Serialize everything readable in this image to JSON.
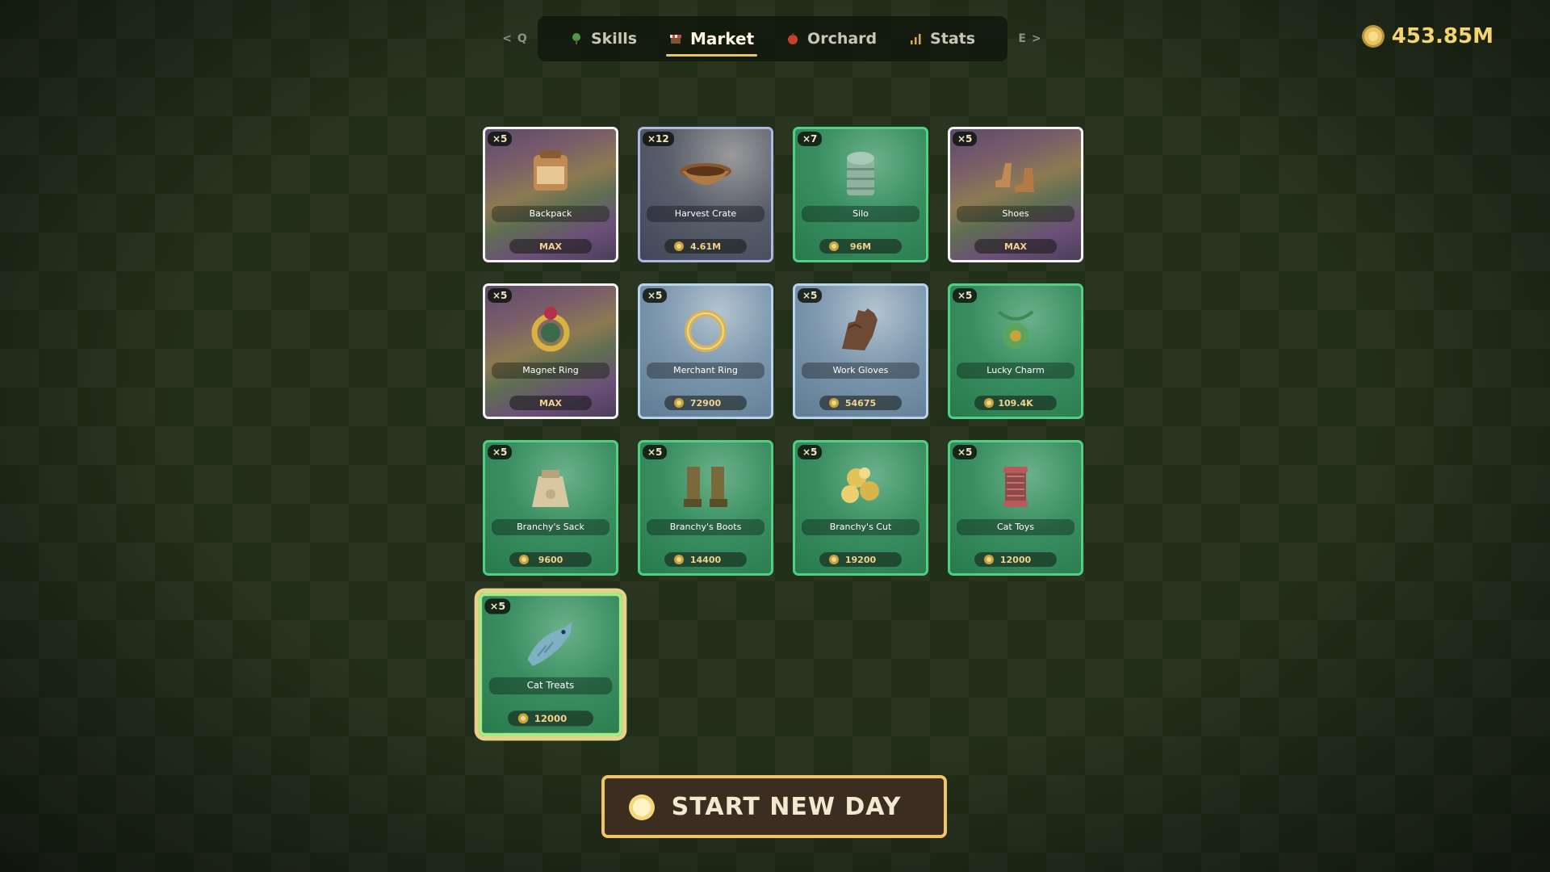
{
  "nav": {
    "prev_hint": "< Q",
    "next_hint": "E >",
    "tabs": [
      {
        "label": "Skills",
        "icon": "tree-icon",
        "active": false
      },
      {
        "label": "Market",
        "icon": "market-stall-icon",
        "active": true
      },
      {
        "label": "Orchard",
        "icon": "apple-icon",
        "active": false
      },
      {
        "label": "Stats",
        "icon": "bar-chart-icon",
        "active": false
      }
    ]
  },
  "currency": {
    "icon": "coin-icon",
    "total": "453.85M"
  },
  "items": [
    {
      "name": "Backpack",
      "qty": "×5",
      "price": "MAX",
      "style": "rainbow",
      "icon": "backpack-icon"
    },
    {
      "name": "Harvest Crate",
      "qty": "×12",
      "price": "4.61M",
      "style": "silver",
      "icon": "crate-icon"
    },
    {
      "name": "Silo",
      "qty": "×7",
      "price": "96M",
      "style": "green",
      "icon": "silo-icon"
    },
    {
      "name": "Shoes",
      "qty": "×5",
      "price": "MAX",
      "style": "rainbow",
      "icon": "shoes-icon"
    },
    {
      "name": "Magnet Ring",
      "qty": "×5",
      "price": "MAX",
      "style": "rainbow",
      "icon": "magnet-ring-icon"
    },
    {
      "name": "Merchant Ring",
      "qty": "×5",
      "price": "72900",
      "style": "sky",
      "icon": "ring-icon"
    },
    {
      "name": "Work Gloves",
      "qty": "×5",
      "price": "54675",
      "style": "sky",
      "icon": "glove-icon"
    },
    {
      "name": "Lucky Charm",
      "qty": "×5",
      "price": "109.4K",
      "style": "green",
      "icon": "charm-icon"
    },
    {
      "name": "Branchy's Sack",
      "qty": "×5",
      "price": "9600",
      "style": "green",
      "icon": "sack-icon"
    },
    {
      "name": "Branchy's Boots",
      "qty": "×5",
      "price": "14400",
      "style": "green",
      "icon": "boots-icon"
    },
    {
      "name": "Branchy's Cut",
      "qty": "×5",
      "price": "19200",
      "style": "green",
      "icon": "gold-nuggets-icon"
    },
    {
      "name": "Cat Toys",
      "qty": "×5",
      "price": "12000",
      "style": "green",
      "icon": "yarn-spool-icon"
    },
    {
      "name": "Cat Treats",
      "qty": "×5",
      "price": "12000",
      "style": "green",
      "icon": "fish-icon",
      "selected": true
    }
  ],
  "start_button": {
    "label": "START NEW DAY",
    "icon": "sun-coin-icon"
  },
  "colors": {
    "gold": "#f0c564",
    "coin_text": "#f5d36d",
    "green_border": "#4fd082",
    "background": "#23301a"
  }
}
